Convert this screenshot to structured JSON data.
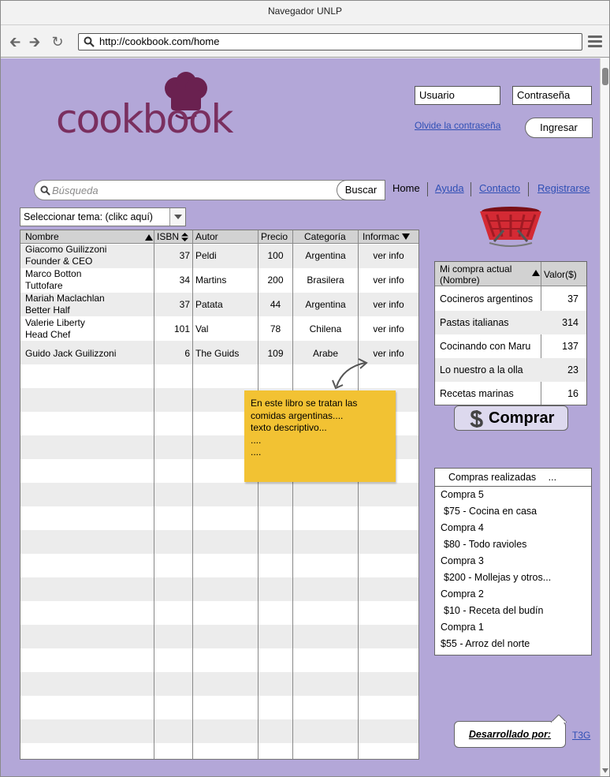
{
  "browser": {
    "title": "Navegador UNLP",
    "url": "http://cookbook.com/home"
  },
  "logo": {
    "text": "cookbook"
  },
  "login": {
    "user_placeholder": "Usuario",
    "password_placeholder": "Contraseña",
    "forgot_link": "Olvide la contraseña",
    "submit_label": "Ingresar"
  },
  "search": {
    "placeholder": "Búsqueda",
    "button_label": "Buscar"
  },
  "topnav": {
    "home": "Home",
    "help": "Ayuda",
    "contact": "Contacto",
    "register": "Registrarse"
  },
  "theme_select": {
    "value": "Seleccionar tema: (clikc aquí)"
  },
  "books_table": {
    "headers": {
      "name": "Nombre",
      "isbn": "ISBN",
      "author": "Autor",
      "price": "Precio",
      "category": "Categoría",
      "info": "Informac"
    },
    "rows": [
      {
        "name1": "Giacomo Guilizzoni",
        "name2": "Founder & CEO",
        "isbn": "37",
        "author": "Peldi",
        "price": "100",
        "category": "Argentina",
        "info": "ver info"
      },
      {
        "name1": "Marco Botton",
        "name2": "Tuttofare",
        "isbn": "34",
        "author": "Martins",
        "price": "200",
        "category": "Brasilera",
        "info": "ver info"
      },
      {
        "name1": "Mariah Maclachlan",
        "name2": "Better Half",
        "isbn": "37",
        "author": "Patata",
        "price": "44",
        "category": "Argentina",
        "info": "ver info"
      },
      {
        "name1": "Valerie Liberty",
        "name2": "Head Chef",
        "isbn": "101",
        "author": "Val",
        "price": "78",
        "category": "Chilena",
        "info": "ver info"
      },
      {
        "name1": "Guido Jack Guilizzoni",
        "name2": "",
        "isbn": "6",
        "author": "The Guids",
        "price": "109",
        "category": "Arabe",
        "info": "ver info"
      }
    ]
  },
  "info_note": {
    "line1": "En este libro se tratan las",
    "line2": "comidas argentinas....",
    "line3": "texto descriptivo...",
    "line4": "....",
    "line5": "...."
  },
  "cart": {
    "header_name": "Mi compra actual (Nombre)",
    "header_value": "Valor($)",
    "rows": [
      {
        "name": "Cocineros argentinos",
        "value": "37"
      },
      {
        "name": "Pastas italianas",
        "value": "314"
      },
      {
        "name": "Cocinando con Maru",
        "value": "137"
      },
      {
        "name": "Lo nuestro a la olla",
        "value": "23"
      },
      {
        "name": "Recetas marinas",
        "value": "16"
      }
    ],
    "buy_label": "Comprar"
  },
  "history": {
    "header": "Compras realizadas",
    "header_more": "...",
    "items": [
      {
        "title": "Compra 5",
        "detail": "$75 - Cocina en casa"
      },
      {
        "title": "Compra 4",
        "detail": "$80 - Todo ravioles"
      },
      {
        "title": "Compra 3",
        "detail": "$200 - Mollejas y otros..."
      },
      {
        "title": "Compra 2",
        "detail": "$10 - Receta del budín"
      },
      {
        "title": "Compra 1",
        "detail": "$55 - Arroz del norte"
      }
    ]
  },
  "footer": {
    "developed_by": "Desarrollado por:",
    "team_link": "T3G"
  },
  "colors": {
    "page_background": "#b3a7d8",
    "logo": "#7a2f5f",
    "note": "#f2c233",
    "link": "#2f4fb5",
    "basket": "#d42a34"
  }
}
